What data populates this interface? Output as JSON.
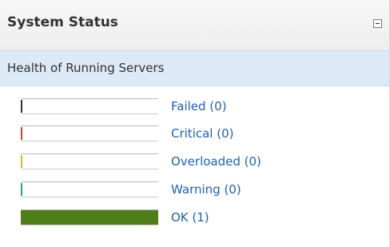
{
  "panel": {
    "title": "System Status"
  },
  "section": {
    "title": "Health of Running Servers"
  },
  "statuses": [
    {
      "label": "Failed (0)",
      "color": "#333333",
      "count": 0
    },
    {
      "label": "Critical (0)",
      "color": "#d83c3c",
      "count": 0
    },
    {
      "label": "Overloaded (0)",
      "color": "#e6b422",
      "count": 0
    },
    {
      "label": "Warning (0)",
      "color": "#2a9a9a",
      "count": 0
    },
    {
      "label": "OK (1)",
      "color": "#4e7d1a",
      "count": 1
    }
  ],
  "total_servers": 1,
  "icons": {
    "collapse": "minus-box-icon"
  }
}
